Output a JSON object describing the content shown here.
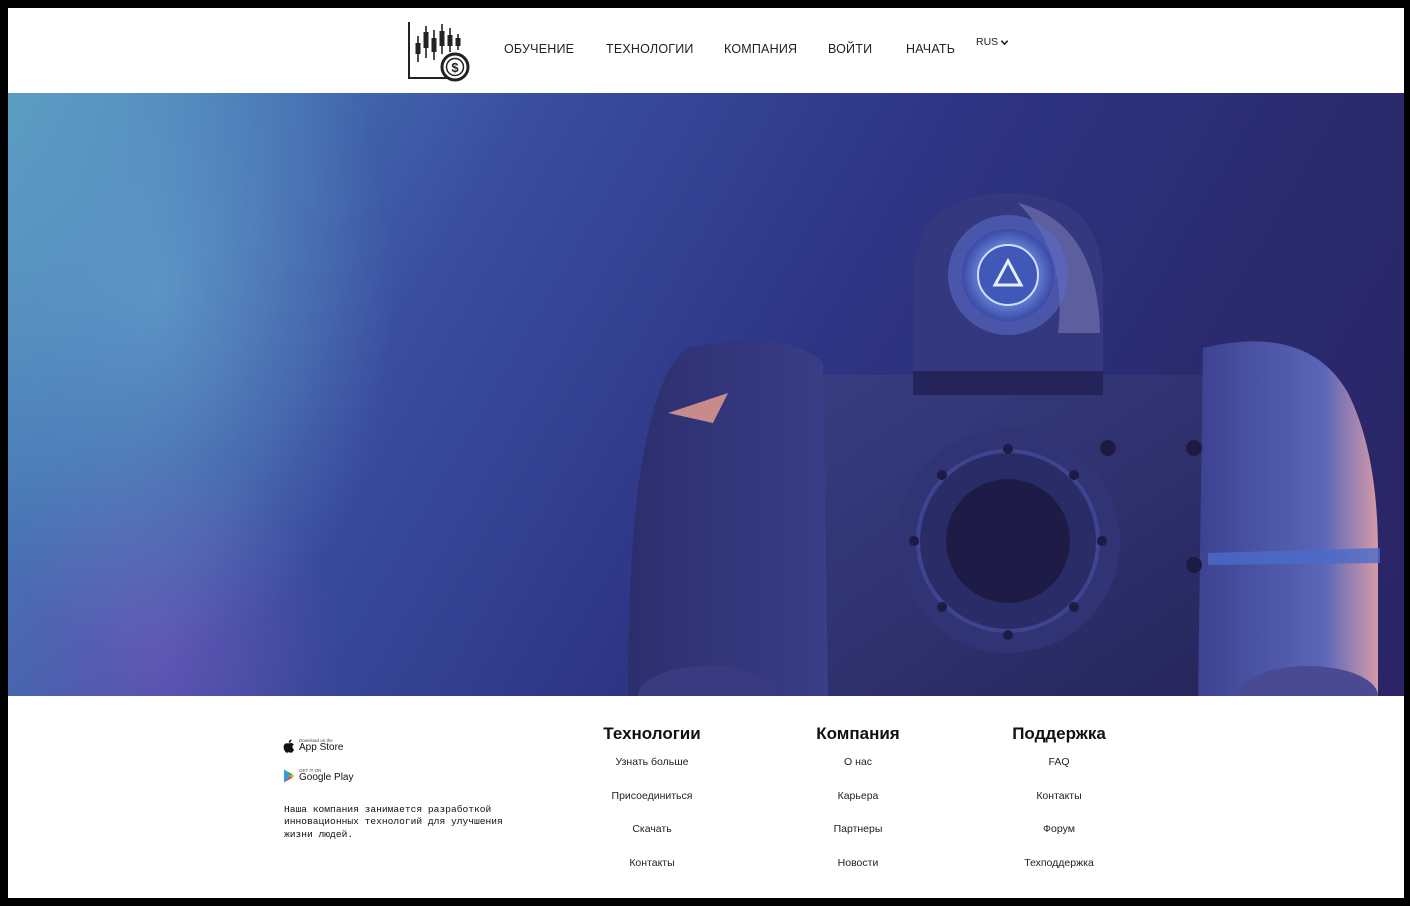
{
  "header": {
    "nav": [
      {
        "label": "ОБУЧЕНИЕ",
        "name": "nav-learning"
      },
      {
        "label": "ТЕХНОЛОГИИ",
        "name": "nav-technologies"
      },
      {
        "label": "КОМПАНИЯ",
        "name": "nav-company"
      },
      {
        "label": "ВОЙТИ",
        "name": "nav-login"
      },
      {
        "label": "НАЧАТЬ",
        "name": "nav-start"
      }
    ],
    "language": "RUS"
  },
  "footer": {
    "app_store": {
      "small": "Download on the",
      "big": "App Store"
    },
    "google_play": {
      "small": "GET IT ON",
      "big": "Google Play"
    },
    "description": "Наша компания занимается разработкой инновационных технологий для улучшения жизни людей.",
    "columns": [
      {
        "title": "Технологии",
        "links": [
          "Узнать больше",
          "Присоединиться",
          "Скачать",
          "Контакты"
        ]
      },
      {
        "title": "Компания",
        "links": [
          "О нас",
          "Карьера",
          "Партнеры",
          "Новости"
        ]
      },
      {
        "title": "Поддержка",
        "links": [
          "FAQ",
          "Контакты",
          "Форум",
          "Техподдержка"
        ]
      }
    ]
  },
  "colors": {
    "hero_dark": "#2a2a6c",
    "hero_light": "#5a9cc0",
    "text": "#222222"
  }
}
